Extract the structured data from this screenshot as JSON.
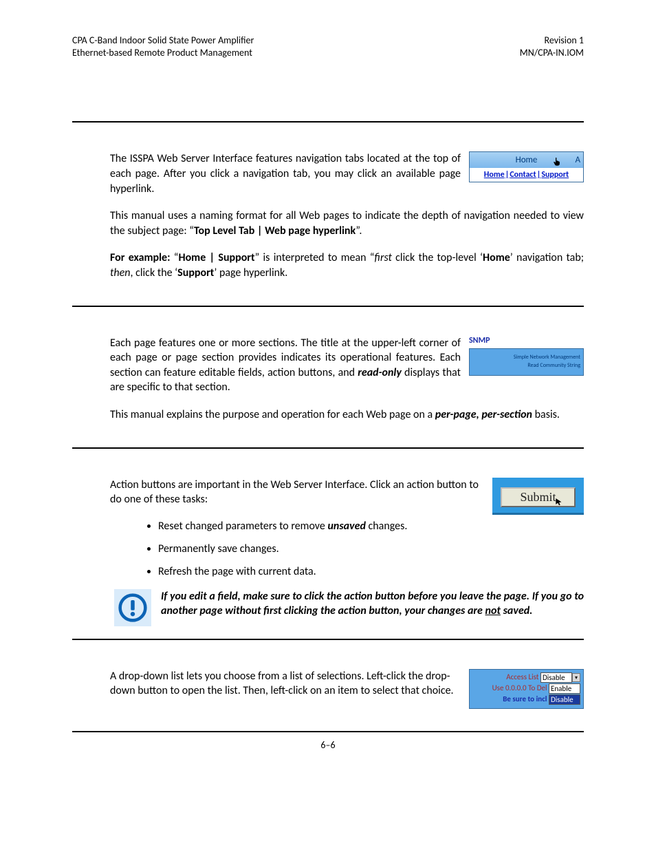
{
  "header": {
    "left_line1": "CPA C-Band Indoor Solid State Power Amplifier",
    "left_line2": "Ethernet-based Remote Product Management",
    "right_line1": "Revision 1",
    "right_line2": "MN/CPA-IN.IOM"
  },
  "nav_image": {
    "tab_label": "Home",
    "tab_extra": "A",
    "links": [
      "Home",
      "Contact",
      "Support"
    ]
  },
  "section1": {
    "p1": "The ISSPA Web Server Interface features navigation tabs located at the top of each page. After you click a navigation tab, you may click an available page hyperlink.",
    "p2_pre": "This manual uses a naming format for all Web pages to indicate the depth of navigation needed to view the subject page: “",
    "p2_bold": "Top Level Tab | Web page hyperlink",
    "p2_post": "”.",
    "p3_label": "For example:",
    "p3_a": " “",
    "p3_home": "Home | Support",
    "p3_b": "” is interpreted to mean “",
    "p3_first": "first",
    "p3_c": " click the top-level ‘",
    "p3_d": "Home",
    "p3_e": "’ navigation tab; ",
    "p3_then": "then",
    "p3_f": ", click the ‘",
    "p3_g": "Support",
    "p3_h": "’ page hyperlink."
  },
  "snmp_image": {
    "label": "SNMP",
    "line1": "Simple Network Management",
    "line2": "Read Community String"
  },
  "section2": {
    "p1_a": "Each page features one or more sections. The title at the upper-left corner of each page or page section provides indicates its operational features. Each section can feature editable fields, action buttons, and ",
    "p1_ro": "read-only",
    "p1_b": " displays that are specific to that section.",
    "p2_a": "This manual explains the purpose and operation for each Web page on a ",
    "p2_b": "per-page, per-section",
    "p2_c": " basis."
  },
  "submit_image": {
    "button": "Submit"
  },
  "section3": {
    "p1": "Action buttons are important in the Web Server Interface. Click an action button to do one of these tasks:",
    "b1_a": "Reset changed parameters to remove ",
    "b1_b": "unsaved",
    "b1_c": " changes.",
    "b2": "Permanently save changes.",
    "b3": "Refresh the page with current data.",
    "note_a": "If you edit a field, make sure to click the action button before you leave the page. If you go to another page without first clicking the action button, your changes are ",
    "note_b": "not",
    "note_c": " saved."
  },
  "dd_image": {
    "row1_label": "Access List",
    "row1_value": "Disable",
    "row2_label": "Use 0.0.0.0 To Del",
    "row2_value": "Enable",
    "row3_label": "Be sure to incl",
    "row3_value": "Disable"
  },
  "section4": {
    "p1": "A drop-down list lets you choose from a list of selections. Left-click the drop-down button to open the list. Then, left-click on an item to select that choice."
  },
  "footer": {
    "page": "6–6"
  }
}
